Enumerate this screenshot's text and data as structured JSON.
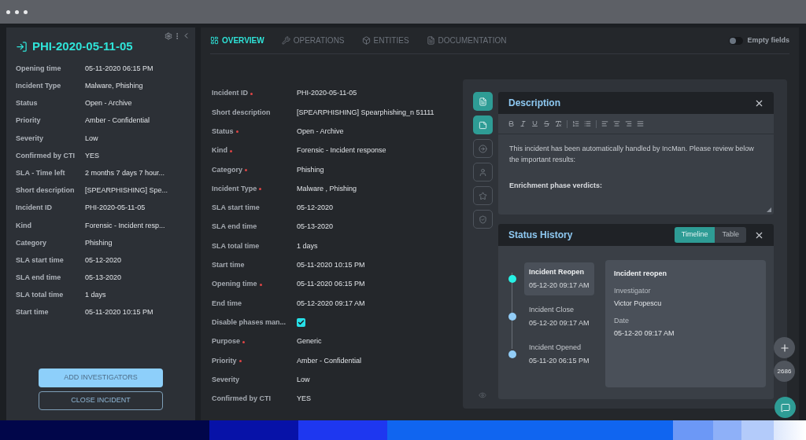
{
  "incident_panel": {
    "title": "PHI-2020-05-11-05",
    "fields": [
      {
        "label": "Opening time",
        "value": "05-11-2020 06:15 PM"
      },
      {
        "label": "Incident Type",
        "value": "Malware, Phishing"
      },
      {
        "label": "Status",
        "value": "Open - Archive"
      },
      {
        "label": "Priority",
        "value": "Amber - Confidential"
      },
      {
        "label": "Severity",
        "value": "Low"
      },
      {
        "label": "Confirmed by CTI",
        "value": "YES"
      },
      {
        "label": "SLA - Time left",
        "value": "2 months 7 days 7 hour..."
      },
      {
        "label": "Short description",
        "value": "[SPEARPHISHING] Spe..."
      },
      {
        "label": "Incident ID",
        "value": "PHI-2020-05-11-05"
      },
      {
        "label": "Kind",
        "value": "Forensic - Incident resp..."
      },
      {
        "label": "Category",
        "value": "Phishing"
      },
      {
        "label": "SLA start time",
        "value": "05-12-2020"
      },
      {
        "label": "SLA end time",
        "value": "05-13-2020"
      },
      {
        "label": "SLA total time",
        "value": "1 days"
      },
      {
        "label": "Start time",
        "value": "05-11-2020 10:15 PM"
      }
    ],
    "buttons": [
      {
        "label": "ADD INVESTIGATORS",
        "kind": "primary"
      },
      {
        "label": "CLOSE INCIDENT",
        "kind": "outline"
      }
    ]
  },
  "tabs": [
    {
      "label": "OVERVIEW",
      "kind": "overview",
      "selected": true
    },
    {
      "label": "OPERATIONS",
      "kind": "operations",
      "selected": false
    },
    {
      "label": "ENTITIES",
      "kind": "entities",
      "selected": false
    },
    {
      "label": "DOCUMENTATION",
      "kind": "documentation",
      "selected": false
    }
  ],
  "empty_fields_toggle": {
    "label": "Empty fields",
    "on": false
  },
  "form": [
    {
      "label": "Incident ID",
      "required": true,
      "kind": "text",
      "value": "PHI-2020-05-11-05"
    },
    {
      "label": "Short description",
      "required": false,
      "kind": "text",
      "value": "[SPEARPHISHING] Spearphishing_n 51111"
    },
    {
      "label": "Status",
      "required": true,
      "kind": "text",
      "value": "Open - Archive"
    },
    {
      "label": "Kind",
      "required": true,
      "kind": "text",
      "value": "Forensic - Incident response"
    },
    {
      "label": "Category",
      "required": true,
      "kind": "text",
      "value": "Phishing"
    },
    {
      "label": "Incident Type",
      "required": true,
      "kind": "text",
      "value": "Malware , Phishing"
    },
    {
      "label": "SLA start time",
      "required": false,
      "kind": "text",
      "value": "05-12-2020"
    },
    {
      "label": "SLA end time",
      "required": false,
      "kind": "text",
      "value": "05-13-2020"
    },
    {
      "label": "SLA total time",
      "required": false,
      "kind": "text",
      "value": "1 days"
    },
    {
      "label": "Start time",
      "required": false,
      "kind": "text",
      "value": "05-11-2020 10:15 PM"
    },
    {
      "label": "Opening time",
      "required": true,
      "kind": "text",
      "value": "05-11-2020 06:15 PM"
    },
    {
      "label": "End time",
      "required": false,
      "kind": "text",
      "value": "05-12-2020 09:17 AM"
    },
    {
      "label": "Disable phases man...",
      "required": false,
      "kind": "checkbox",
      "checked": true
    },
    {
      "label": "Purpose",
      "required": true,
      "kind": "text",
      "value": "Generic"
    },
    {
      "label": "Priority",
      "required": true,
      "kind": "text",
      "value": "Amber - Confidential"
    },
    {
      "label": "Severity",
      "required": false,
      "kind": "text",
      "value": "Low"
    },
    {
      "label": "Confirmed by CTI",
      "required": false,
      "kind": "text",
      "value": "YES"
    }
  ],
  "side_icons": [
    {
      "kind": "document",
      "selected": true
    },
    {
      "kind": "note",
      "selected": true
    },
    {
      "kind": "arrow",
      "selected": false
    },
    {
      "kind": "user",
      "selected": false
    },
    {
      "kind": "star",
      "selected": false
    },
    {
      "kind": "shield",
      "selected": false
    }
  ],
  "description": {
    "title": "Description",
    "text": "This incident has been automatically handled by IncMan. Please review below the important results:",
    "heading": "Enrichment phase verdicts:"
  },
  "status_history": {
    "title": "Status History",
    "views": [
      {
        "label": "Timeline",
        "selected": true
      },
      {
        "label": "Table",
        "selected": false
      }
    ],
    "events": [
      {
        "title": "Incident Reopen",
        "time": "05-12-20 09:17 AM",
        "selected": true
      },
      {
        "title": "Incident Close",
        "time": "05-12-20 09:17 AM",
        "selected": false
      },
      {
        "title": "Incident Opened",
        "time": "05-11-20 06:15 PM",
        "selected": false
      }
    ],
    "detail": {
      "title": "Incident reopen",
      "fields": [
        {
          "label": "Investigator",
          "value": "Victor Popescu"
        },
        {
          "label": "Date",
          "value": "05-12-20 09:17 AM"
        }
      ]
    }
  },
  "counter": "2686"
}
